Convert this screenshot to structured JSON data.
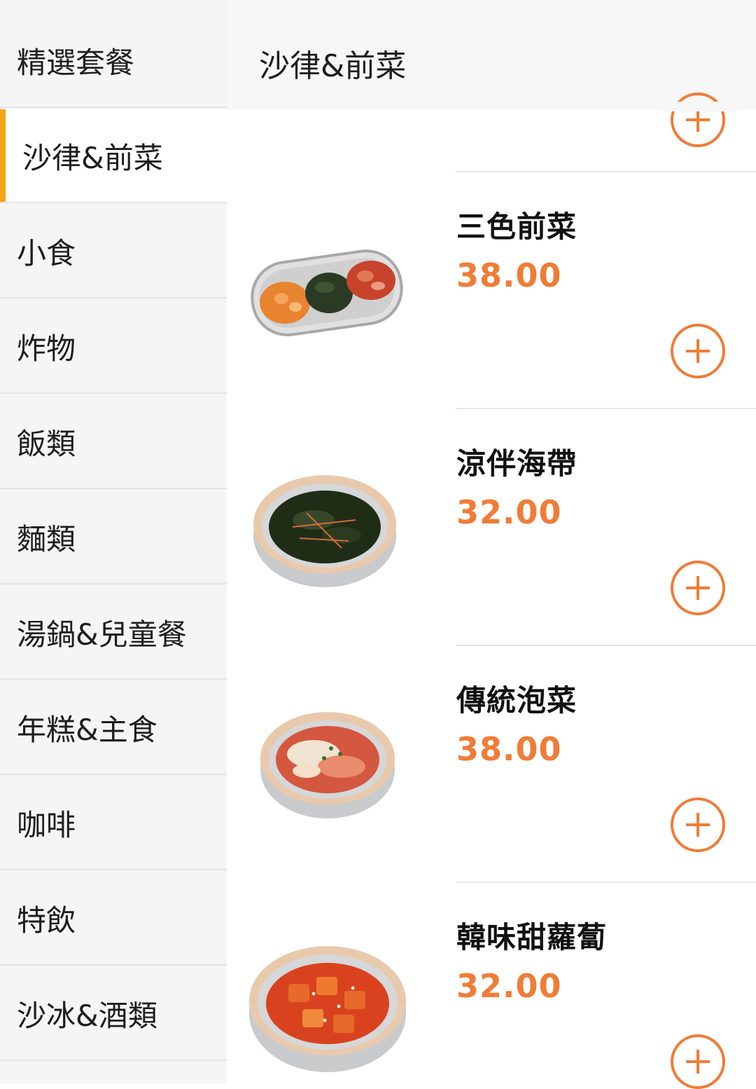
{
  "sidebar": {
    "items": [
      {
        "label": "精選套餐"
      },
      {
        "label": "沙律&前菜",
        "active": true
      },
      {
        "label": "小食"
      },
      {
        "label": "炸物"
      },
      {
        "label": "飯類"
      },
      {
        "label": "麵類"
      },
      {
        "label": "湯鍋&兒童餐"
      },
      {
        "label": "年糕&主食"
      },
      {
        "label": "咖啡"
      },
      {
        "label": "特飲"
      },
      {
        "label": "沙冰&酒類"
      }
    ]
  },
  "header": {
    "title": "沙律&前菜"
  },
  "products": [
    {
      "name": "三色前菜",
      "price": "38.00",
      "image": "three-side-dish-tray"
    },
    {
      "name": "涼伴海帶",
      "price": "32.00",
      "image": "seaweed-salad-bowl"
    },
    {
      "name": "傳統泡菜",
      "price": "38.00",
      "image": "kimchi-bowl"
    },
    {
      "name": "韓味甜蘿蔔",
      "price": "32.00",
      "image": "radish-kimchi-bowl"
    }
  ],
  "colors": {
    "accent": "#f07c36",
    "active_marker": "#f6a316"
  },
  "icons": {
    "add": "plus-circle-icon"
  }
}
